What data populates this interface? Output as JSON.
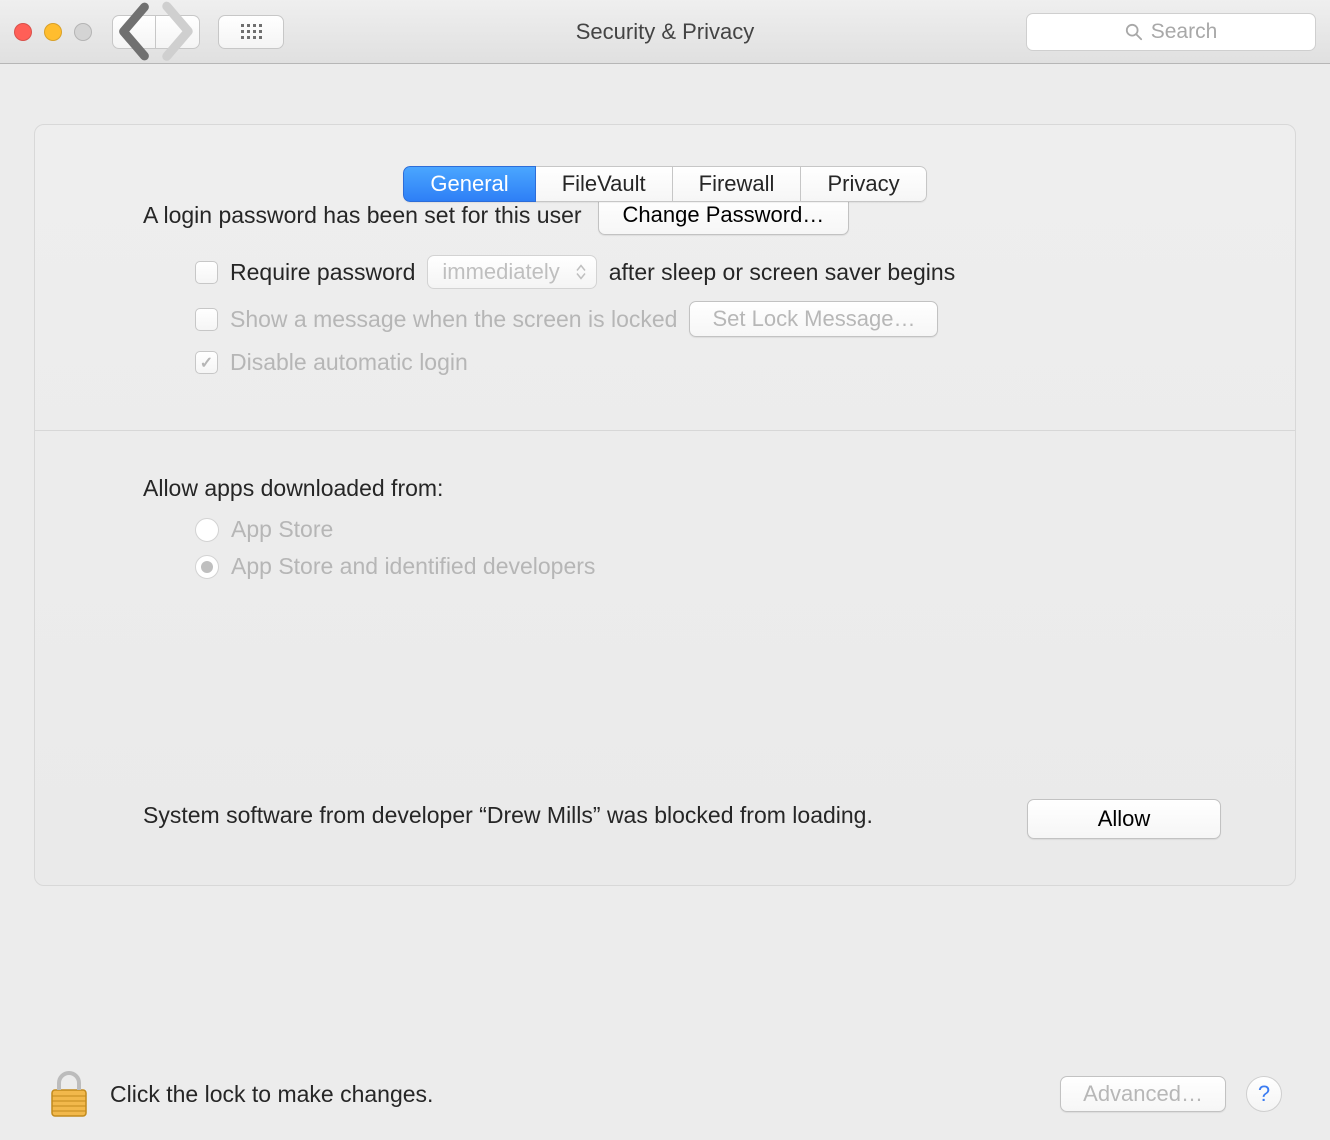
{
  "window": {
    "title": "Security & Privacy"
  },
  "search": {
    "placeholder": "Search"
  },
  "tabs": {
    "general": "General",
    "filevault": "FileVault",
    "firewall": "Firewall",
    "privacy": "Privacy"
  },
  "loginSection": {
    "loginPasswordSet": "A login password has been set for this user",
    "changePassword": "Change Password…",
    "requirePassword": "Require password",
    "delaySelected": "immediately",
    "afterSleep": "after sleep or screen saver begins",
    "showLockMessage": "Show a message when the screen is locked",
    "setLockMessage": "Set Lock Message…",
    "disableAutoLogin": "Disable automatic login"
  },
  "allowSection": {
    "title": "Allow apps downloaded from:",
    "optAppStore": "App Store",
    "optIdentified": "App Store and identified developers"
  },
  "blockedSection": {
    "message": "System software from developer “Drew Mills” was blocked from loading.",
    "allow": "Allow"
  },
  "footer": {
    "lockText": "Click the lock to make changes.",
    "advanced": "Advanced…"
  }
}
